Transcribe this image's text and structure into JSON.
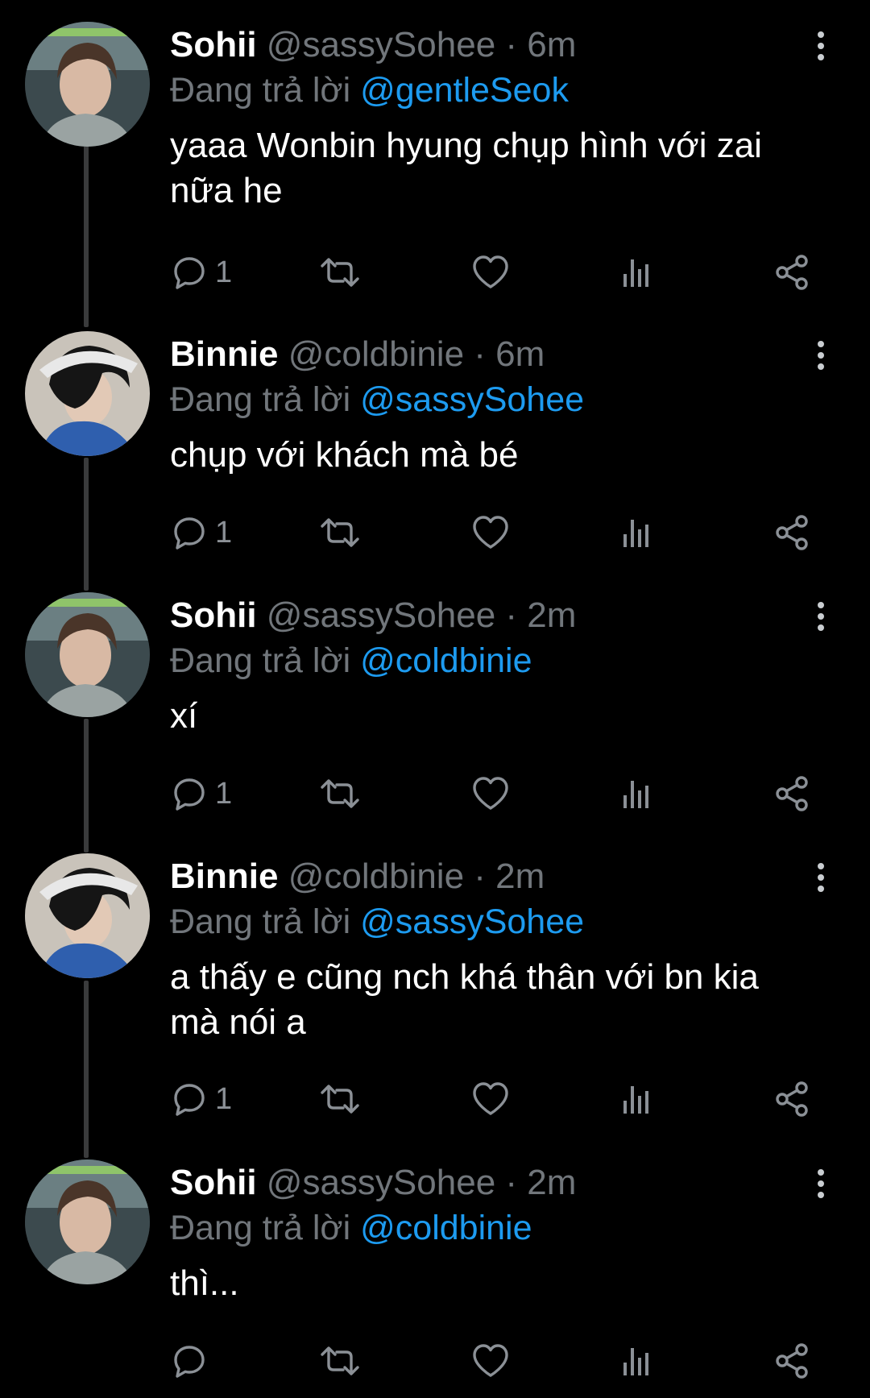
{
  "colors": {
    "background": "#000000",
    "name": "#ffffff",
    "muted": "#71767b",
    "mention": "#1d9bf0",
    "thread_line": "#3a3b3c"
  },
  "reply_prefix": "Đang trả lời",
  "separator": "·",
  "tweets": [
    {
      "name": "Sohii",
      "handle": "@sassySohee",
      "time": "6m",
      "replying_to": "@gentleSeok",
      "text": "yaaa Wonbin hyung chụp hình với zai nữa he",
      "reply_count": "1",
      "avatar": "avatar-sohee"
    },
    {
      "name": "Binnie",
      "handle": "@coldbinie",
      "time": "6m",
      "replying_to": "@sassySohee",
      "text": "chụp với khách mà bé",
      "reply_count": "1",
      "avatar": "avatar-binnie"
    },
    {
      "name": "Sohii",
      "handle": "@sassySohee",
      "time": "2m",
      "replying_to": "@coldbinie",
      "text": "xí",
      "reply_count": "1",
      "avatar": "avatar-sohee"
    },
    {
      "name": "Binnie",
      "handle": "@coldbinie",
      "time": "2m",
      "replying_to": "@sassySohee",
      "text": "a thấy e cũng nch khá thân với bn kia mà nói a",
      "reply_count": "1",
      "avatar": "avatar-binnie"
    },
    {
      "name": "Sohii",
      "handle": "@sassySohee",
      "time": "2m",
      "replying_to": "@coldbinie",
      "text": "thì...",
      "reply_count": "",
      "avatar": "avatar-sohee"
    }
  ],
  "action_icons": [
    "reply-icon",
    "retweet-icon",
    "like-icon",
    "views-icon",
    "share-icon"
  ]
}
